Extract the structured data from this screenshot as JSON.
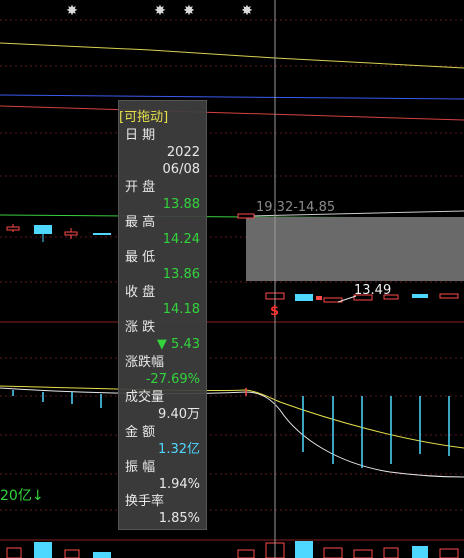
{
  "colors": {
    "background": "#000000",
    "up": "#ff4a4a",
    "down": "#32d43c",
    "cyan": "#4fd8ff",
    "yellow": "#e6e04a",
    "grid": "#5a1a1a"
  },
  "markers": {
    "star_glyph": "✸"
  },
  "range_text": "19.32-14.85",
  "low_price_label": "13.49",
  "flag_glyph": "$",
  "bottom_left_text": "20亿↓",
  "tooltip": {
    "header": "[可拖动]",
    "date_label": "日 期",
    "date_year": "2022",
    "date_md": "06/08",
    "open_label": "开 盘",
    "open_value": "13.88",
    "high_label": "最 高",
    "high_value": "14.24",
    "low_label": "最 低",
    "low_value": "13.86",
    "close_label": "收 盘",
    "close_value": "14.18",
    "change_label": "涨 跌",
    "change_value": "▼ 5.43",
    "change_pct_label": "涨跌幅",
    "change_pct_value": "-27.69%",
    "volume_label": "成交量",
    "volume_value": "9.40万",
    "amount_label": "金 额",
    "amount_value": "1.32亿",
    "amplitude_label": "振 幅",
    "amplitude_value": "1.94%",
    "turnover_label": "换手率",
    "turnover_value": "1.85%"
  }
}
